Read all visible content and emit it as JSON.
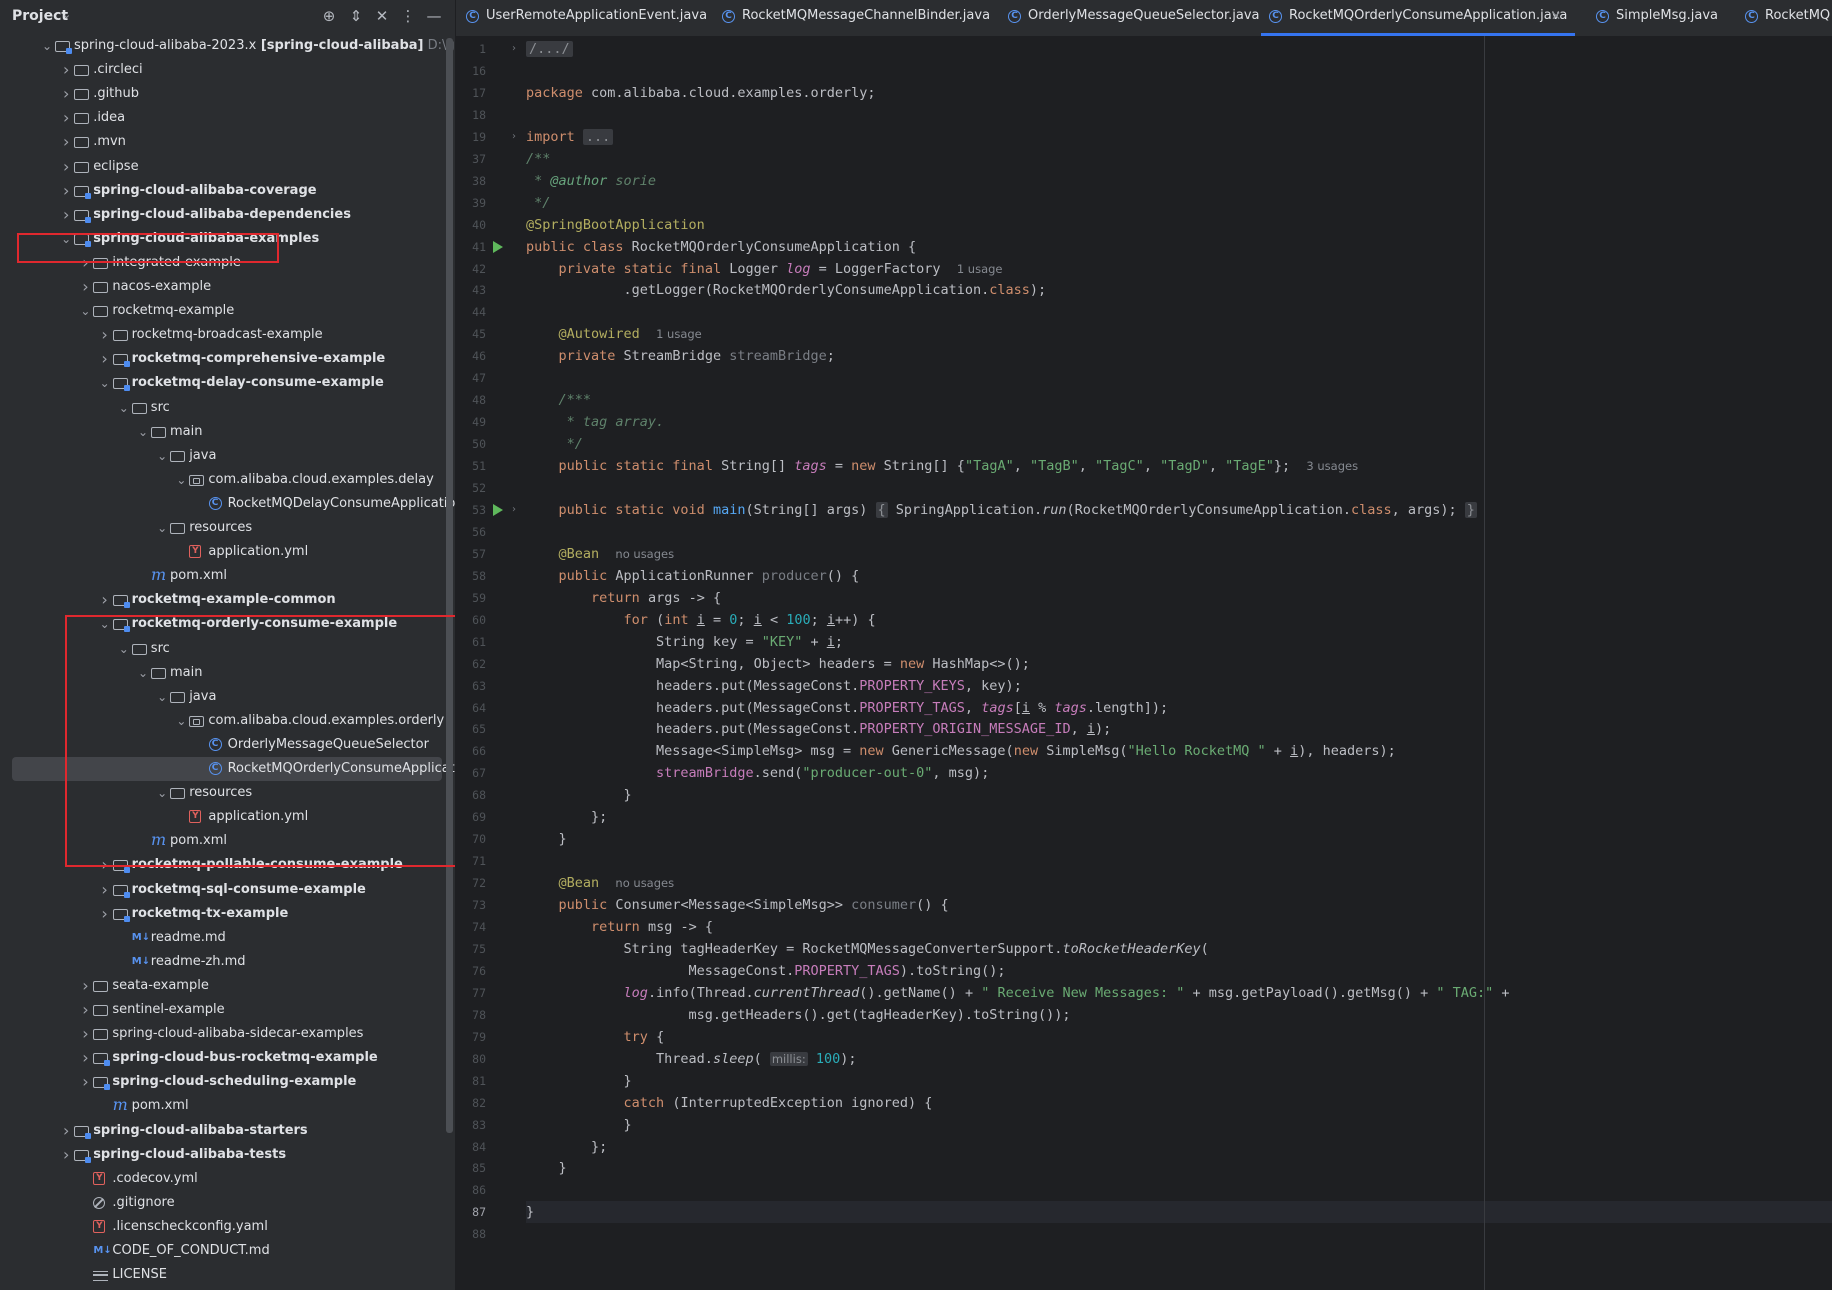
{
  "sidebar": {
    "title": "Project",
    "tree": [
      {
        "label": "spring-cloud-alibaba-2023.x",
        "bold_suffix": "[spring-cloud-alibaba]",
        "path": "D:\\github\\rocke",
        "depth": 0,
        "arrow": "down",
        "icon": "module-folder",
        "bold": false
      },
      {
        "label": ".circleci",
        "depth": 1,
        "arrow": "right",
        "icon": "folder",
        "bold": false
      },
      {
        "label": ".github",
        "depth": 1,
        "arrow": "right",
        "icon": "folder",
        "bold": false
      },
      {
        "label": ".idea",
        "depth": 1,
        "arrow": "right",
        "icon": "folder",
        "bold": false
      },
      {
        "label": ".mvn",
        "depth": 1,
        "arrow": "right",
        "icon": "folder",
        "bold": false
      },
      {
        "label": "eclipse",
        "depth": 1,
        "arrow": "right",
        "icon": "folder",
        "bold": false
      },
      {
        "label": "spring-cloud-alibaba-coverage",
        "depth": 1,
        "arrow": "right",
        "icon": "module-folder",
        "bold": true
      },
      {
        "label": "spring-cloud-alibaba-dependencies",
        "depth": 1,
        "arrow": "right",
        "icon": "module-folder",
        "bold": true
      },
      {
        "label": "spring-cloud-alibaba-examples",
        "depth": 1,
        "arrow": "down",
        "icon": "module-folder",
        "bold": true
      },
      {
        "label": "integrated-example",
        "depth": 2,
        "arrow": "right",
        "icon": "folder",
        "bold": false
      },
      {
        "label": "nacos-example",
        "depth": 2,
        "arrow": "right",
        "icon": "folder",
        "bold": false
      },
      {
        "label": "rocketmq-example",
        "depth": 2,
        "arrow": "down",
        "icon": "folder",
        "bold": false
      },
      {
        "label": "rocketmq-broadcast-example",
        "depth": 3,
        "arrow": "right",
        "icon": "folder",
        "bold": false
      },
      {
        "label": "rocketmq-comprehensive-example",
        "depth": 3,
        "arrow": "right",
        "icon": "module-folder",
        "bold": true
      },
      {
        "label": "rocketmq-delay-consume-example",
        "depth": 3,
        "arrow": "down",
        "icon": "module-folder",
        "bold": true
      },
      {
        "label": "src",
        "depth": 4,
        "arrow": "down",
        "icon": "folder",
        "bold": false
      },
      {
        "label": "main",
        "depth": 5,
        "arrow": "down",
        "icon": "folder",
        "bold": false
      },
      {
        "label": "java",
        "depth": 6,
        "arrow": "down",
        "icon": "folder",
        "bold": false
      },
      {
        "label": "com.alibaba.cloud.examples.delay",
        "depth": 7,
        "arrow": "down",
        "icon": "package",
        "bold": false
      },
      {
        "label": "RocketMQDelayConsumeApplication",
        "depth": 8,
        "arrow": "",
        "icon": "class",
        "bold": false
      },
      {
        "label": "resources",
        "depth": 6,
        "arrow": "down",
        "icon": "folder",
        "bold": false
      },
      {
        "label": "application.yml",
        "depth": 7,
        "arrow": "",
        "icon": "yaml",
        "bold": false
      },
      {
        "label": "pom.xml",
        "depth": 5,
        "arrow": "",
        "icon": "maven",
        "bold": false
      },
      {
        "label": "rocketmq-example-common",
        "depth": 3,
        "arrow": "right",
        "icon": "module-folder",
        "bold": true
      },
      {
        "label": "rocketmq-orderly-consume-example",
        "depth": 3,
        "arrow": "down",
        "icon": "module-folder",
        "bold": true
      },
      {
        "label": "src",
        "depth": 4,
        "arrow": "down",
        "icon": "folder",
        "bold": false
      },
      {
        "label": "main",
        "depth": 5,
        "arrow": "down",
        "icon": "folder",
        "bold": false
      },
      {
        "label": "java",
        "depth": 6,
        "arrow": "down",
        "icon": "folder",
        "bold": false
      },
      {
        "label": "com.alibaba.cloud.examples.orderly",
        "depth": 7,
        "arrow": "down",
        "icon": "package",
        "bold": false
      },
      {
        "label": "OrderlyMessageQueueSelector",
        "depth": 8,
        "arrow": "",
        "icon": "class",
        "bold": false
      },
      {
        "label": "RocketMQOrderlyConsumeApplication",
        "depth": 8,
        "arrow": "",
        "icon": "class",
        "bold": false,
        "selected": true
      },
      {
        "label": "resources",
        "depth": 6,
        "arrow": "down",
        "icon": "folder",
        "bold": false
      },
      {
        "label": "application.yml",
        "depth": 7,
        "arrow": "",
        "icon": "yaml",
        "bold": false
      },
      {
        "label": "pom.xml",
        "depth": 5,
        "arrow": "",
        "icon": "maven",
        "bold": false
      },
      {
        "label": "rocketmq-pollable-consume-example",
        "depth": 3,
        "arrow": "right",
        "icon": "module-folder",
        "bold": true
      },
      {
        "label": "rocketmq-sql-consume-example",
        "depth": 3,
        "arrow": "right",
        "icon": "module-folder",
        "bold": true
      },
      {
        "label": "rocketmq-tx-example",
        "depth": 3,
        "arrow": "right",
        "icon": "module-folder",
        "bold": true
      },
      {
        "label": "readme.md",
        "depth": 4,
        "arrow": "",
        "icon": "markdown",
        "bold": false
      },
      {
        "label": "readme-zh.md",
        "depth": 4,
        "arrow": "",
        "icon": "markdown",
        "bold": false
      },
      {
        "label": "seata-example",
        "depth": 2,
        "arrow": "right",
        "icon": "folder",
        "bold": false
      },
      {
        "label": "sentinel-example",
        "depth": 2,
        "arrow": "right",
        "icon": "folder",
        "bold": false
      },
      {
        "label": "spring-cloud-alibaba-sidecar-examples",
        "depth": 2,
        "arrow": "right",
        "icon": "folder",
        "bold": false
      },
      {
        "label": "spring-cloud-bus-rocketmq-example",
        "depth": 2,
        "arrow": "right",
        "icon": "module-folder",
        "bold": true
      },
      {
        "label": "spring-cloud-scheduling-example",
        "depth": 2,
        "arrow": "right",
        "icon": "module-folder",
        "bold": true
      },
      {
        "label": "pom.xml",
        "depth": 3,
        "arrow": "",
        "icon": "maven",
        "bold": false
      },
      {
        "label": "spring-cloud-alibaba-starters",
        "depth": 1,
        "arrow": "right",
        "icon": "module-folder",
        "bold": true
      },
      {
        "label": "spring-cloud-alibaba-tests",
        "depth": 1,
        "arrow": "right",
        "icon": "module-folder",
        "bold": true
      },
      {
        "label": ".codecov.yml",
        "depth": 2,
        "arrow": "",
        "icon": "yaml",
        "bold": false
      },
      {
        "label": ".gitignore",
        "depth": 2,
        "arrow": "",
        "icon": "ignore",
        "bold": false
      },
      {
        "label": ".licenscheckconfig.yaml",
        "depth": 2,
        "arrow": "",
        "icon": "yaml",
        "bold": false
      },
      {
        "label": "CODE_OF_CONDUCT.md",
        "depth": 2,
        "arrow": "",
        "icon": "markdown",
        "bold": false
      },
      {
        "label": "LICENSE",
        "depth": 2,
        "arrow": "",
        "icon": "text",
        "bold": false
      }
    ]
  },
  "tabs": [
    {
      "label": "UserRemoteApplicationEvent.java",
      "active": false
    },
    {
      "label": "RocketMQMessageChannelBinder.java",
      "active": false
    },
    {
      "label": "OrderlyMessageQueueSelector.java",
      "active": false
    },
    {
      "label": "RocketMQOrderlyConsumeApplication.java",
      "active": true
    },
    {
      "label": "SimpleMsg.java",
      "active": false
    },
    {
      "label": "RocketMQ",
      "active": false
    }
  ],
  "editor": {
    "current_line": "87",
    "lines": [
      {
        "no": "1",
        "html": "<span class=\"fold-ph\">/.../</span>",
        "fold": true
      },
      {
        "no": "16",
        "html": ""
      },
      {
        "no": "17",
        "html": "<span class=\"k\">package</span> com.alibaba.cloud.examples.orderly;"
      },
      {
        "no": "18",
        "html": ""
      },
      {
        "no": "19",
        "html": "<span class=\"k\">import</span> <span class=\"fold-ph\">...</span>",
        "fold": true
      },
      {
        "no": "37",
        "html": "<span class=\"cd\">/**</span>"
      },
      {
        "no": "38",
        "html": "<span class=\"cd\"> * </span><span class=\"cdt\">@author</span><span class=\"cd\"> sorie</span>"
      },
      {
        "no": "39",
        "html": "<span class=\"cd\"> */</span>"
      },
      {
        "no": "40",
        "html": "<span class=\"a\">@SpringBootApplication</span>"
      },
      {
        "no": "41",
        "html": "<span class=\"k\">public class</span> RocketMQOrderlyConsumeApplication {",
        "run": true
      },
      {
        "no": "42",
        "html": "    <span class=\"k\">private static final</span> Logger <span class=\"fi\">log</span> = LoggerFactory  <span class=\"hint\">1 usage</span>"
      },
      {
        "no": "43",
        "html": "            .getLogger(RocketMQOrderlyConsumeApplication.<span class=\"k\">class</span>);"
      },
      {
        "no": "44",
        "html": ""
      },
      {
        "no": "45",
        "html": "    <span class=\"a\">@Autowired</span>  <span class=\"hint\">1 usage</span>"
      },
      {
        "no": "46",
        "html": "    <span class=\"k\">private</span> StreamBridge <span class=\"c\">streamBridge</span>;"
      },
      {
        "no": "47",
        "html": ""
      },
      {
        "no": "48",
        "html": "    <span class=\"cd\">/***</span>"
      },
      {
        "no": "49",
        "html": "    <span class=\"cd\"> * tag array.</span>"
      },
      {
        "no": "50",
        "html": "    <span class=\"cd\"> */</span>"
      },
      {
        "no": "51",
        "html": "    <span class=\"k\">public static final</span> String[] <span class=\"fi\">tags</span> = <span class=\"k\">new</span> String[] {<span class=\"s\">\"TagA\"</span>, <span class=\"s\">\"TagB\"</span>, <span class=\"s\">\"TagC\"</span>, <span class=\"s\">\"TagD\"</span>, <span class=\"s\">\"TagE\"</span>};  <span class=\"hint\">3 usages</span>"
      },
      {
        "no": "52",
        "html": ""
      },
      {
        "no": "53",
        "html": "    <span class=\"k\">public static void</span> <span class=\"m\">main</span>(String[] args) <span class=\"ph\">{</span> SpringApplication.<span class=\"it\">run</span>(RocketMQOrderlyConsumeApplication.<span class=\"k\">class</span>, args); <span class=\"ph\">}</span>",
        "run": true,
        "fold": true
      },
      {
        "no": "56",
        "html": ""
      },
      {
        "no": "57",
        "html": "    <span class=\"a\">@Bean</span>  <span class=\"hint\">no usages</span>"
      },
      {
        "no": "58",
        "html": "    <span class=\"k\">public</span> ApplicationRunner <span class=\"c\">producer</span>() {"
      },
      {
        "no": "59",
        "html": "        <span class=\"k\">return</span> args -&gt; {"
      },
      {
        "no": "60",
        "html": "            <span class=\"k\">for</span> (<span class=\"k\">int</span> <span class=\"und\">i</span> = <span class=\"n\">0</span>; <span class=\"und\">i</span> &lt; <span class=\"n\">100</span>; <span class=\"und\">i</span>++) {"
      },
      {
        "no": "61",
        "html": "                String key = <span class=\"s\">\"KEY\"</span> + <span class=\"und\">i</span>;"
      },
      {
        "no": "62",
        "html": "                Map&lt;String, Object&gt; headers = <span class=\"k\">new</span> HashMap&lt;&gt;();"
      },
      {
        "no": "63",
        "html": "                headers.put(MessageConst.<span class=\"f\">PROPERTY_KEYS</span>, key);"
      },
      {
        "no": "64",
        "html": "                headers.put(MessageConst.<span class=\"f\">PROPERTY_TAGS</span>, <span class=\"fi\">tags</span>[<span class=\"und\">i</span> % <span class=\"fi\">tags</span>.length]);"
      },
      {
        "no": "65",
        "html": "                headers.put(MessageConst.<span class=\"f\">PROPERTY_ORIGIN_MESSAGE_ID</span>, <span class=\"und\">i</span>);"
      },
      {
        "no": "66",
        "html": "                Message&lt;SimpleMsg&gt; msg = <span class=\"k\">new</span> GenericMessage(<span class=\"k\">new</span> SimpleMsg(<span class=\"s\">\"Hello RocketMQ \"</span> + <span class=\"und\">i</span>), headers);"
      },
      {
        "no": "67",
        "html": "                <span class=\"f\">streamBridge</span>.send(<span class=\"s\">\"producer-out-0\"</span>, msg);"
      },
      {
        "no": "68",
        "html": "            }"
      },
      {
        "no": "69",
        "html": "        };"
      },
      {
        "no": "70",
        "html": "    }"
      },
      {
        "no": "71",
        "html": ""
      },
      {
        "no": "72",
        "html": "    <span class=\"a\">@Bean</span>  <span class=\"hint\">no usages</span>"
      },
      {
        "no": "73",
        "html": "    <span class=\"k\">public</span> Consumer&lt;Message&lt;SimpleMsg&gt;&gt; <span class=\"c\">consumer</span>() {"
      },
      {
        "no": "74",
        "html": "        <span class=\"k\">return</span> msg -&gt; {"
      },
      {
        "no": "75",
        "html": "            String tagHeaderKey = RocketMQMessageConverterSupport.<span class=\"it\">toRocketHeaderKey</span>("
      },
      {
        "no": "76",
        "html": "                    MessageConst.<span class=\"f\">PROPERTY_TAGS</span>).toString();"
      },
      {
        "no": "77",
        "html": "            <span class=\"fi\">log</span>.info(Thread.<span class=\"it\">currentThread</span>().getName() + <span class=\"s\">\" Receive New Messages: \"</span> + msg.getPayload().getMsg() + <span class=\"s\">\" TAG:\"</span> +"
      },
      {
        "no": "78",
        "html": "                    msg.getHeaders().get(tagHeaderKey).toString());"
      },
      {
        "no": "79",
        "html": "            <span class=\"k\">try</span> {"
      },
      {
        "no": "80",
        "html": "                Thread.<span class=\"it\">sleep</span>( <span class=\"ph hint\">millis:</span> <span class=\"n\">100</span>);"
      },
      {
        "no": "81",
        "html": "            }"
      },
      {
        "no": "82",
        "html": "            <span class=\"k\">catch</span> (InterruptedException ignored) {"
      },
      {
        "no": "83",
        "html": "            }"
      },
      {
        "no": "84",
        "html": "        };"
      },
      {
        "no": "85",
        "html": "    }"
      },
      {
        "no": "86",
        "html": ""
      },
      {
        "no": "87",
        "html": "}"
      },
      {
        "no": "88",
        "html": ""
      }
    ]
  }
}
